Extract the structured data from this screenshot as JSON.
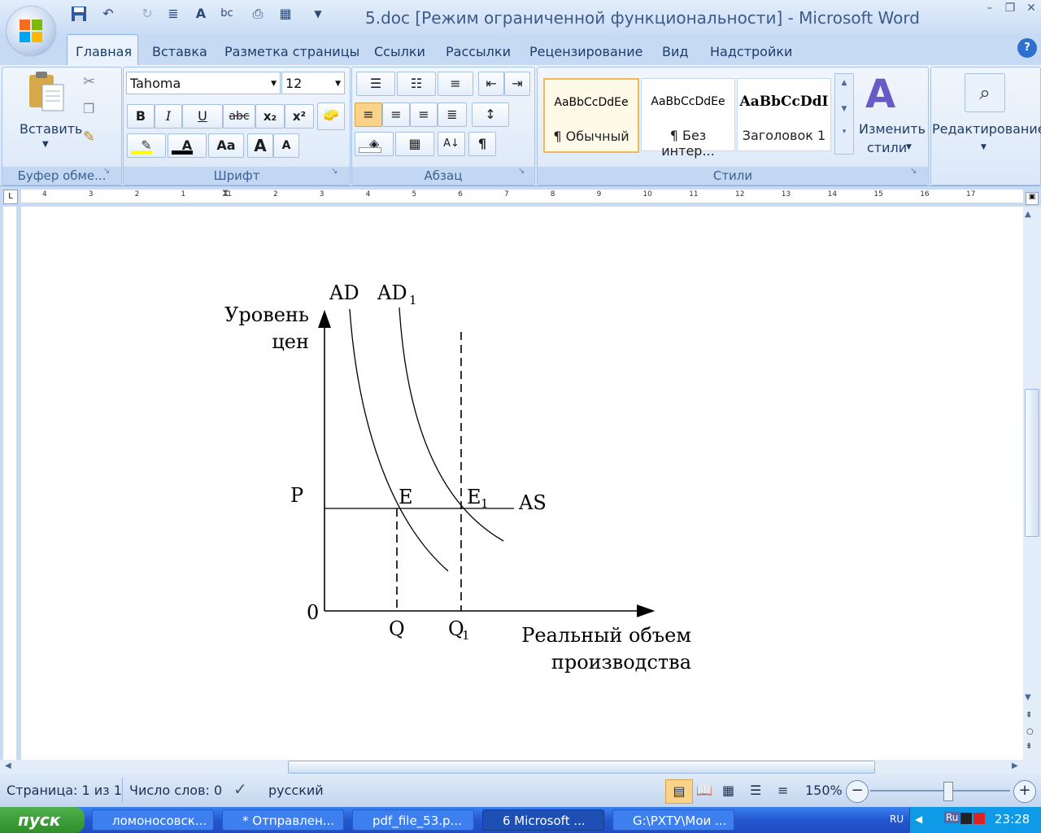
{
  "window": {
    "title": "5.doc [Режим ограниченной функциональности] - Microsoft Word"
  },
  "tabs": [
    "Главная",
    "Вставка",
    "Разметка страницы",
    "Ссылки",
    "Рассылки",
    "Рецензирование",
    "Вид",
    "Надстройки"
  ],
  "ribbon": {
    "clipboard": {
      "paste_label": "Вставить",
      "group_label": "Буфер обме..."
    },
    "font": {
      "font_name": "Tahoma",
      "font_size": "12",
      "group_label": "Шрифт",
      "bold": "B",
      "italic": "I",
      "underline": "U",
      "strike": "abc",
      "sub": "x₂",
      "sup": "x²",
      "case": "Aa",
      "grow": "A",
      "shrink": "A"
    },
    "paragraph": {
      "group_label": "Абзац",
      "pilcrow": "¶"
    },
    "styles": {
      "group_label": "Стили",
      "items": [
        {
          "sample": "AaBbCcDdEe",
          "name": "¶ Обычный"
        },
        {
          "sample": "AaBbCcDdEe",
          "name": "¶ Без интер..."
        },
        {
          "sample": "AaBbCcDdI",
          "name": "Заголовок 1"
        }
      ],
      "change_label_1": "Изменить",
      "change_label_2": "стили"
    },
    "editing": {
      "label": "Редактирование"
    }
  },
  "ruler": {
    "ticks": [
      "4",
      "3",
      "2",
      "1",
      "1",
      "2",
      "3",
      "4",
      "5",
      "6",
      "7",
      "8",
      "9",
      "10",
      "11",
      "12",
      "13",
      "14",
      "15",
      "16",
      "17"
    ]
  },
  "chart_data": {
    "type": "line",
    "title": "",
    "ylabel_line1": "Уровень",
    "ylabel_line2": "цен",
    "xlabel_line1": "Реальный объем",
    "xlabel_line2": "производства",
    "origin_label": "0",
    "p_label": "P",
    "q_label": "Q",
    "q1_label": "Q",
    "q1_sub": "1",
    "curves": [
      {
        "name": "AD",
        "label": "AD",
        "sub": ""
      },
      {
        "name": "AD1",
        "label": "AD",
        "sub": "1"
      }
    ],
    "as_label": "AS",
    "points": [
      {
        "label": "E",
        "sub": ""
      },
      {
        "label": "E",
        "sub": "1"
      }
    ]
  },
  "status": {
    "page": "Страница: 1 из 1",
    "words": "Число слов: 0",
    "language": "русский",
    "zoom": "150%"
  },
  "taskbar": {
    "start": "пуск",
    "items": [
      "ломоносовск...",
      "* Отправлен...",
      "pdf_file_53.p...",
      "6 Microsoft ...",
      "G:\\РХТУ\\Мои ..."
    ],
    "lang": "RU",
    "tray_lang": "Ru",
    "clock": "23:28"
  }
}
